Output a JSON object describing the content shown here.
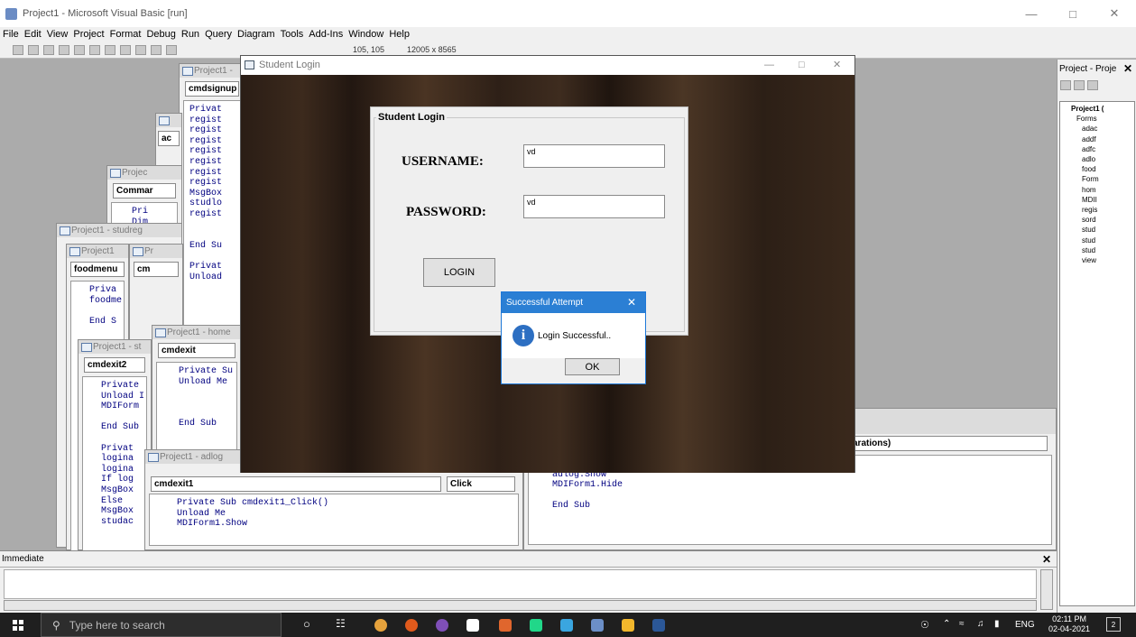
{
  "window": {
    "title": "Project1 - Microsoft Visual Basic [run]"
  },
  "menu": [
    "File",
    "Edit",
    "View",
    "Project",
    "Format",
    "Debug",
    "Run",
    "Query",
    "Diagram",
    "Tools",
    "Add-Ins",
    "Window",
    "Help"
  ],
  "toolbar": {
    "pos_readout": "105, 105",
    "size_readout": "12005 x 8565"
  },
  "bg_windows": [
    {
      "caption": "Project1 -",
      "combo": "cmdsignup",
      "code": "Privat\nregist\nregist\nregist\nregist\nregist\nregist\nregist\nMsgBox\nstudlo\nregist\n\n\nEnd Su\n\nPrivat\nUnload"
    },
    {
      "caption": "",
      "combo": "ac",
      "code": ""
    },
    {
      "caption": "Projec",
      "combo": "Commar",
      "code": "Pri\nDim"
    },
    {
      "caption": "Project1 - studreg",
      "combo": "",
      "code": ""
    },
    {
      "caption": "Project1",
      "combo": "foodmenu",
      "code": "Priva\nfoodme\n\nEnd S"
    },
    {
      "caption": "Pr",
      "combo": "cm",
      "code": ""
    },
    {
      "caption": "Project1 - home",
      "combo": "cmdexit",
      "code": "Private Su\nUnload Me\n\n\n\nEnd Sub"
    },
    {
      "caption": "Project1 - st",
      "combo": "cmdexit2",
      "code": "Private\nUnload I\nMDIForm\n\nEnd Sub\n\nPrivat\nlogina\nlogina\nIf log\nMsgBox\nElse\nMsgBox\nstudac"
    },
    {
      "caption": "Project1 - adlog",
      "combo": "cmdexit1",
      "combo2": "Click",
      "code": "Private Sub cmdexit1_Click()\nUnload Me\nMDIForm1.Show"
    },
    {
      "caption": "",
      "combo": "",
      "combo2": "arations)",
      "code": "Private Sub admin_Click()\nadlog.Show\nMDIForm1.Hide\n\nEnd Sub"
    }
  ],
  "project_panel": {
    "title": "Project - Proje",
    "root": "Project1 (",
    "folder": "Forms",
    "forms": [
      "adac",
      "addf",
      "adfc",
      "adlo",
      "food",
      "Form",
      "hom",
      "MDII",
      "regis",
      "sord",
      "stud",
      "stud",
      "stud",
      "view"
    ]
  },
  "immediate": {
    "title": "Immediate"
  },
  "login_form": {
    "title": "Student Login",
    "frame_label": "Student Login",
    "username_label": "USERNAME:",
    "username_value": "vd",
    "password_label": "PASSWORD:",
    "password_value": "vd",
    "login_button": "LOGIN"
  },
  "msgbox": {
    "title": "Successful Attempt",
    "message": "Login Successful..",
    "ok": "OK"
  },
  "taskbar": {
    "search_placeholder": "Type here to search",
    "lang": "ENG",
    "time": "02:11 PM",
    "date": "02-04-2021",
    "notif_count": "2"
  },
  "colors": {
    "accent": "#2b7fd4",
    "vb_code": "#000080",
    "taskbar": "#1f1f1f"
  }
}
